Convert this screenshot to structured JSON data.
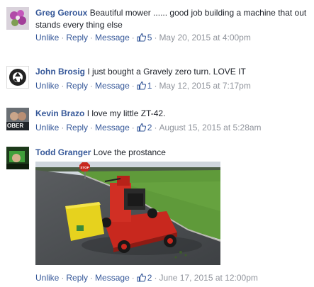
{
  "comments": [
    {
      "author": "Greg Geroux",
      "text": "Beautiful mower ...... good job building a machine that out stands every thing else",
      "actions": {
        "unlike": "Unlike",
        "reply": "Reply",
        "message": "Message",
        "likes": "5",
        "date": "May 20, 2015 at 4:00pm"
      }
    },
    {
      "author": "John Brosig",
      "text": "I just bought a Gravely zero turn. LOVE IT",
      "actions": {
        "unlike": "Unlike",
        "reply": "Reply",
        "message": "Message",
        "likes": "1",
        "date": "May 12, 2015 at 7:17pm"
      }
    },
    {
      "author": "Kevin Brazo",
      "text": "I love my little ZT-42.",
      "actions": {
        "unlike": "Unlike",
        "reply": "Reply",
        "message": "Message",
        "likes": "2",
        "date": "August 15, 2015 at 5:28am"
      }
    },
    {
      "author": "Todd Granger",
      "text": "Love the prostance",
      "actions": {
        "unlike": "Unlike",
        "reply": "Reply",
        "message": "Message",
        "likes": "2",
        "date": "June 17, 2015 at 12:00pm"
      }
    }
  ],
  "photo_sign": "STOP",
  "avatar_text": {
    "kevin": "OBER"
  },
  "colors": {
    "link": "#365899",
    "meta": "#90949c",
    "mower_red": "#c8281e",
    "bagger_yellow": "#e6d21e"
  }
}
